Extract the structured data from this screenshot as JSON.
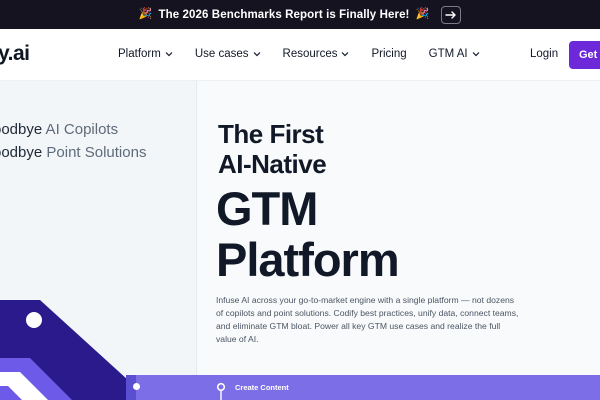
{
  "announcement": {
    "text": "The 2026 Benchmarks Report is Finally Here!",
    "emoji_left": "🎉",
    "emoji_right": "🎉",
    "button_icon": "arrow-right-icon"
  },
  "header": {
    "logo": "y.ai",
    "nav": [
      {
        "label": "Platform",
        "has_dropdown": true
      },
      {
        "label": "Use cases",
        "has_dropdown": true
      },
      {
        "label": "Resources",
        "has_dropdown": true
      },
      {
        "label": "Pricing",
        "has_dropdown": false
      },
      {
        "label": "GTM AI",
        "has_dropdown": true
      }
    ],
    "login": "Login",
    "cta": "Get a"
  },
  "hero": {
    "goodbye_1": {
      "lead": "oodbye",
      "rest": " AI Copilots"
    },
    "goodbye_2": {
      "lead": "oodbye",
      "rest": " Point Solutions"
    },
    "headline_line1": "The First",
    "headline_line2": "AI-Native",
    "headline_line3": "GTM",
    "headline_line4": "Platform",
    "description": "Infuse AI across your go-to-market engine with a single platform — not dozens of copilots and point solutions. Codify best practices, unify data, connect teams, and eliminate GTM bloat. Power all key GTM use cases and realize the full value of AI."
  },
  "band": {
    "label": "Create Content"
  },
  "colors": {
    "announcement_bg": "#161321",
    "cta_bg": "#6d28d9",
    "band_bg": "#7c6ee6",
    "deco_dark": "#2a1a8c",
    "deco_light": "#6d5ae8"
  }
}
